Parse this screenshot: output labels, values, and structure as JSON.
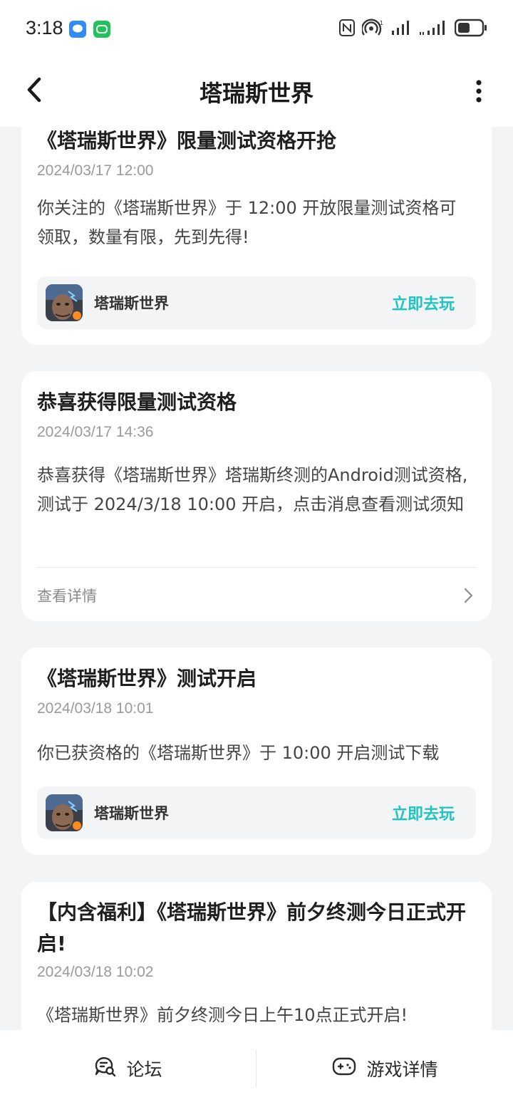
{
  "status_bar": {
    "time": "3:18",
    "app_icons": [
      "message-icon",
      "wechat-icon"
    ],
    "right_icons": [
      "nfc-icon",
      "hotspot-icon",
      "signal-icon",
      "signal-icon-2",
      "battery-icon"
    ]
  },
  "header": {
    "title": "塔瑞斯世界",
    "back_icon": "chevron-left-icon",
    "more_icon": "more-vertical-icon"
  },
  "cards": [
    {
      "title": "《塔瑞斯世界》限量测试资格开抢",
      "date": "2024/03/17 12:00",
      "body": "你关注的《塔瑞斯世界》于 12:00 开放限量测试资格可领取，数量有限，先到先得!",
      "game": {
        "name": "塔瑞斯世界",
        "action": "立即去玩"
      }
    },
    {
      "title": "恭喜获得限量测试资格",
      "date": "2024/03/17 14:36",
      "body": "恭喜获得《塔瑞斯世界》塔瑞斯终测的Android测试资格,测试于 2024/3/18 10:00 开启，点击消息查看测试须知",
      "detail_link": "查看详情"
    },
    {
      "title": "《塔瑞斯世界》测试开启",
      "date": "2024/03/18 10:01",
      "body": "你已获资格的《塔瑞斯世界》于 10:00 开启测试下载",
      "game": {
        "name": "塔瑞斯世界",
        "action": "立即去玩"
      }
    },
    {
      "title": "【内含福利】《塔瑞斯世界》前夕终测今日正式开启!",
      "date": "2024/03/18 10:02",
      "body": "《塔瑞斯世界》前夕终测今日上午10点正式开启!"
    }
  ],
  "bottom_bar": {
    "tabs": [
      {
        "label": "论坛",
        "icon": "forum-icon"
      },
      {
        "label": "游戏详情",
        "icon": "gamepad-icon"
      }
    ]
  },
  "colors": {
    "accent": "#1ec5c0",
    "background": "#f3f4f6",
    "card": "#ffffff"
  }
}
